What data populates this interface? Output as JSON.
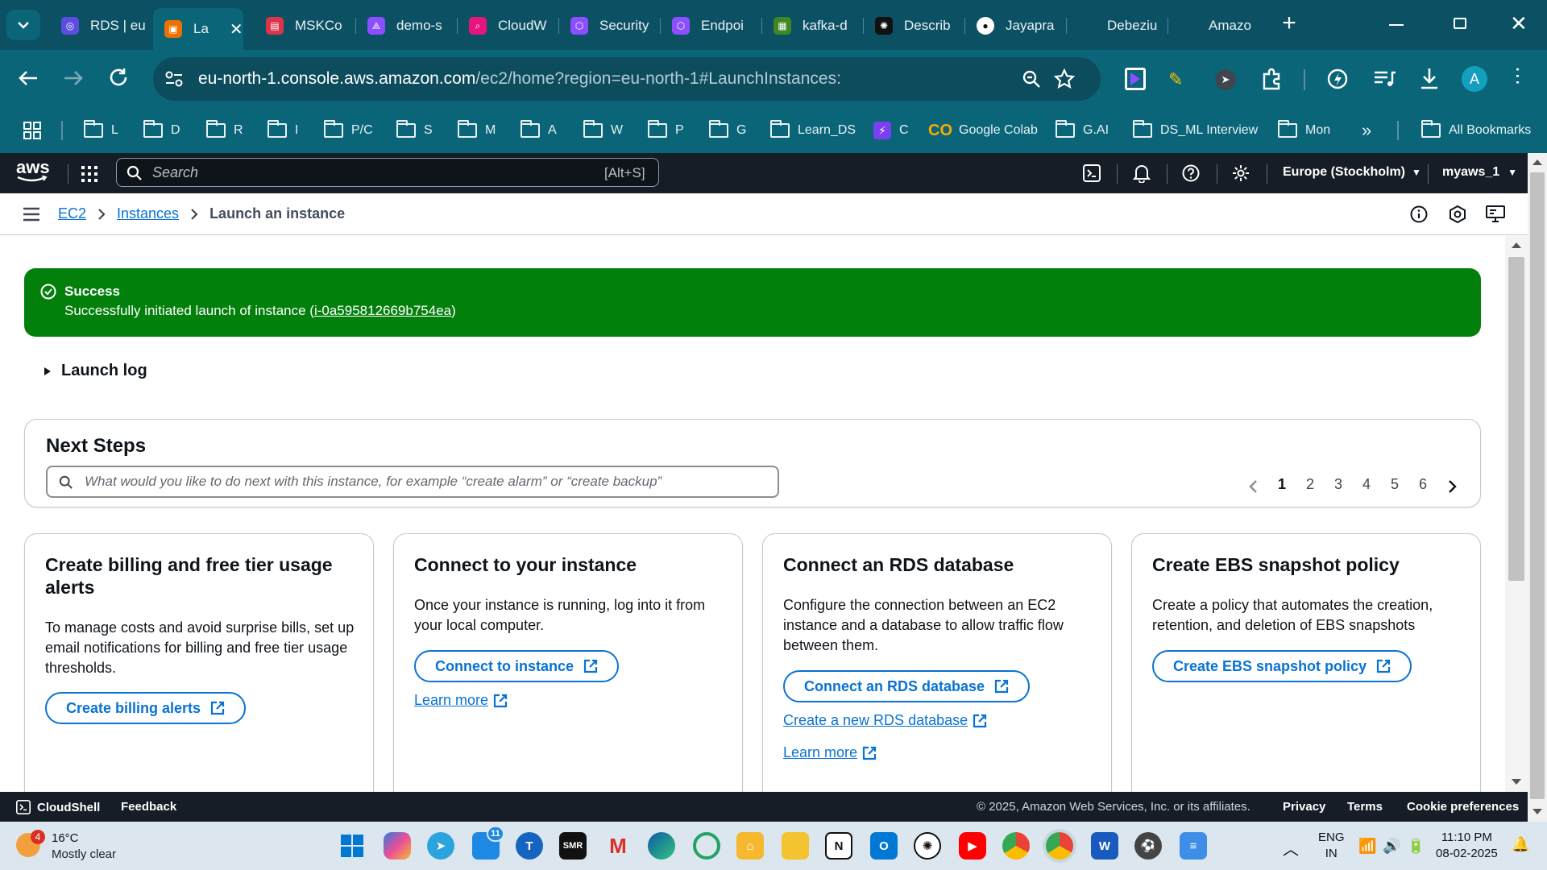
{
  "browser": {
    "tabs": [
      {
        "title": "RDS | eu",
        "color": "#5b4de0",
        "icon": "rds-icon"
      },
      {
        "title": "La",
        "color": "#ed7100",
        "icon": "ec2-icon",
        "active": true
      },
      {
        "title": "MSKCo",
        "color": "#dd344c",
        "icon": "msk-icon"
      },
      {
        "title": "demo-s",
        "color": "#8c4fff",
        "icon": "demo-icon"
      },
      {
        "title": "CloudW",
        "color": "#e7157b",
        "icon": "cloudwatch-icon"
      },
      {
        "title": "Security",
        "color": "#8c4fff",
        "icon": "security-icon"
      },
      {
        "title": "Endpoi",
        "color": "#8c4fff",
        "icon": "endpoint-icon"
      },
      {
        "title": "kafka-d",
        "color": "#3f8624",
        "icon": "kafka-icon"
      },
      {
        "title": "Describ",
        "color": "#111111",
        "icon": "openai-icon"
      },
      {
        "title": "Jayapra",
        "color": "#0c5064",
        "icon": "github-icon"
      },
      {
        "title": "Debeziu",
        "color": "#0c5064",
        "icon": "debezium-icon"
      },
      {
        "title": "Amazo",
        "color": "#0c5064",
        "icon": "amazon-icon"
      }
    ],
    "url_host": "eu-north-1.console.aws.amazon.com",
    "url_path": "/ec2/home?region=eu-north-1#LaunchInstances:",
    "profile_initial": "A",
    "bookmarks": [
      "L",
      "D",
      "R",
      "I",
      "P/C",
      "S",
      "M",
      "A",
      "W",
      "P",
      "G",
      "Learn_DS",
      "C",
      "Google Colab",
      "G.AI",
      "DS_ML Interview",
      "Mon"
    ],
    "all_bookmarks": "All Bookmarks"
  },
  "aws": {
    "logo": "aws",
    "search_placeholder": "Search",
    "search_shortcut": "[Alt+S]",
    "region": "Europe (Stockholm)",
    "account": "myaws_1"
  },
  "breadcrumb": {
    "ec2": "EC2",
    "instances": "Instances",
    "current": "Launch an instance"
  },
  "flash": {
    "title": "Success",
    "message_prefix": "Successfully initiated launch of instance (",
    "instance_id": "i-0a595812669b754ea",
    "message_suffix": ")"
  },
  "launch_log": "Launch log",
  "next_steps": {
    "title": "Next Steps",
    "search_placeholder": "What would you like to do next with this instance, for example “create alarm” or “create backup”",
    "pages": [
      "1",
      "2",
      "3",
      "4",
      "5",
      "6"
    ],
    "current_page": "1"
  },
  "cards": [
    {
      "title_line1": "Create billing and free tier usage",
      "title_line2": "alerts",
      "desc": [
        "To manage costs and avoid surprise bills, set up",
        "email notifications for billing and free tier usage",
        "thresholds."
      ],
      "button": "Create billing alerts"
    },
    {
      "title_line1": "Connect to your instance",
      "desc": [
        "Once your instance is running, log into it from",
        "your local computer."
      ],
      "button": "Connect to instance",
      "link": "Learn more"
    },
    {
      "title_line1": "Connect an RDS database",
      "desc": [
        "Configure the connection between an EC2",
        "instance and a database to allow traffic flow",
        "between them."
      ],
      "button": "Connect an RDS database",
      "link1": "Create a new RDS database",
      "link2": "Learn more"
    },
    {
      "title_line1": "Create EBS snapshot policy",
      "desc": [
        "Create a policy that automates the creation,",
        "retention, and deletion of EBS snapshots"
      ],
      "button": "Create EBS snapshot policy"
    }
  ],
  "footer": {
    "cloudshell": "CloudShell",
    "feedback": "Feedback",
    "copyright": "© 2025, Amazon Web Services, Inc. or its affiliates.",
    "privacy": "Privacy",
    "terms": "Terms",
    "cookies": "Cookie preferences"
  },
  "taskbar": {
    "weather_temp": "16°C",
    "weather_desc": "Mostly clear",
    "weather_badge": "4",
    "lang1": "ENG",
    "lang2": "IN",
    "time": "11:10 PM",
    "date": "08-02-2025",
    "badge_11": "11"
  }
}
